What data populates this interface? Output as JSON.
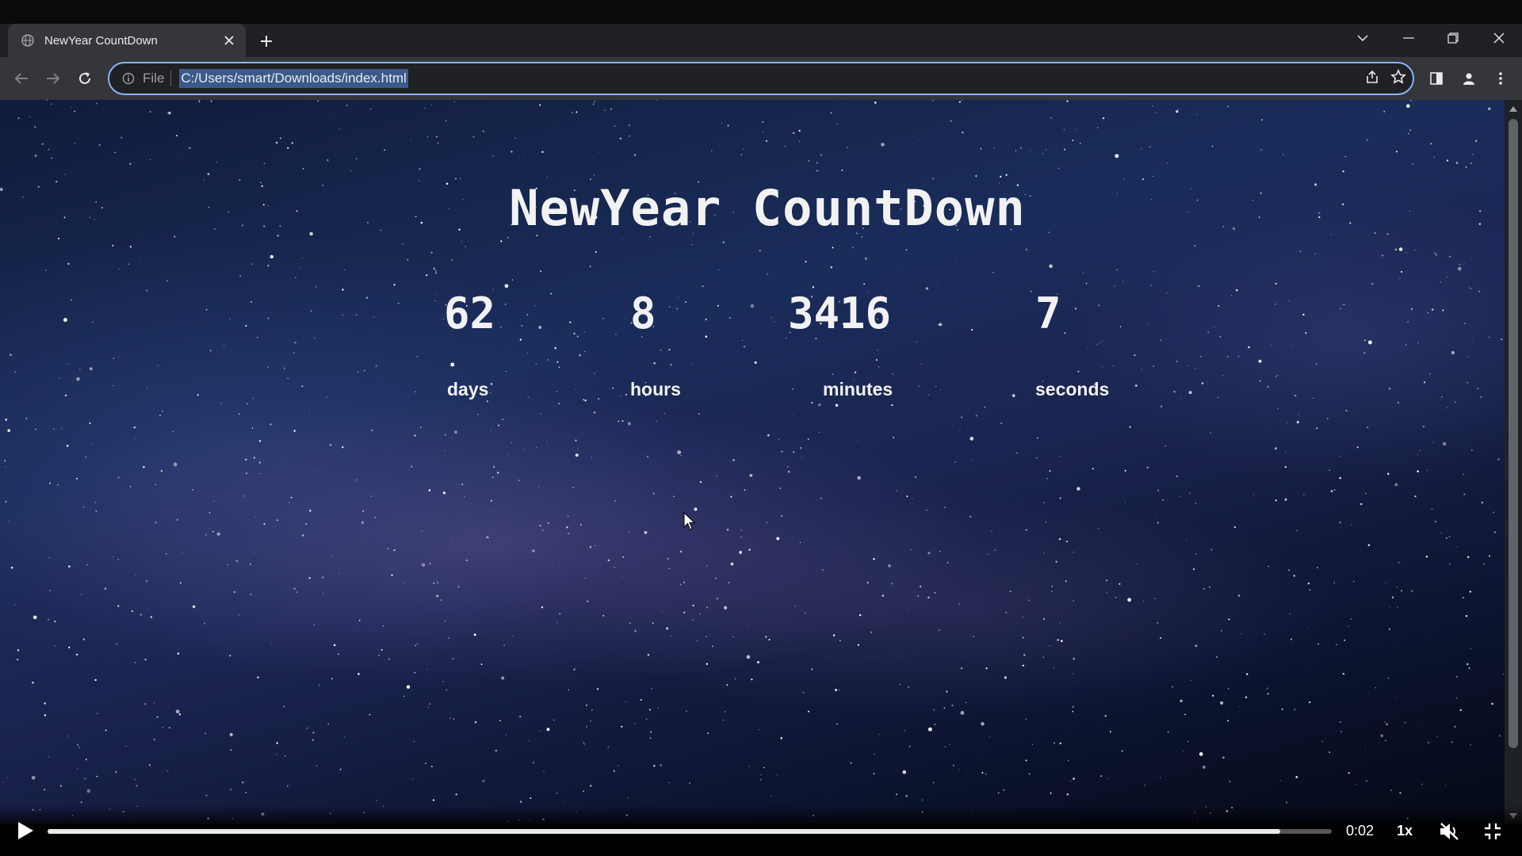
{
  "browser": {
    "tab_title": "NewYear CountDown",
    "url_scheme_label": "File",
    "url": "C:/Users/smart/Downloads/index.html"
  },
  "page": {
    "title": "NewYear CountDown",
    "countdown": [
      {
        "value": "62",
        "label": "days"
      },
      {
        "value": "8",
        "label": "hours"
      },
      {
        "value": "3416",
        "label": "minutes"
      },
      {
        "value": "7",
        "label": "seconds"
      }
    ]
  },
  "video": {
    "time": "0:02",
    "speed": "1x",
    "progress": 0.96
  },
  "colors": {
    "chrome_dark": "#202124",
    "chrome_toolbar": "#35363a",
    "focus_ring": "#8ab4f8",
    "text_light": "#e8eaed",
    "countdown_text": "#f2f2f2"
  }
}
